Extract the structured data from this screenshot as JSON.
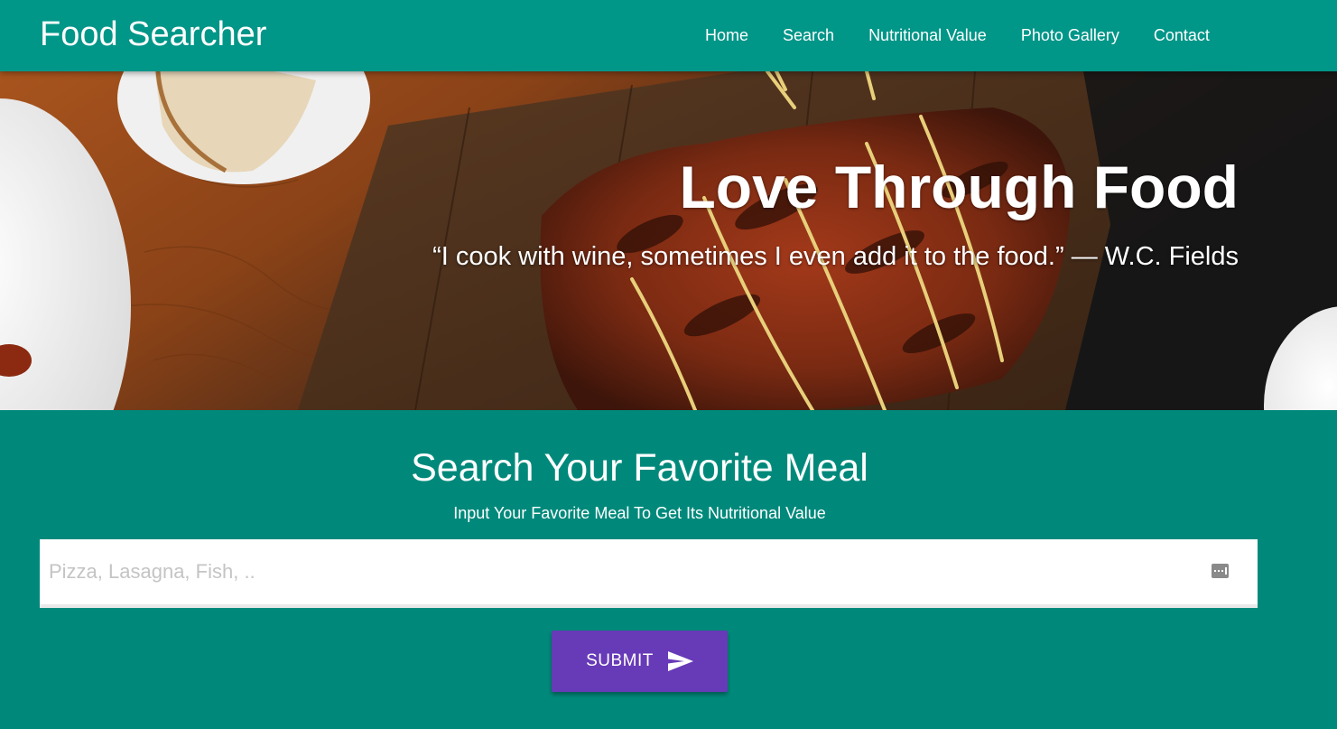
{
  "navbar": {
    "brand": "Food Searcher",
    "links": [
      "Home",
      "Search",
      "Nutritional Value",
      "Photo Gallery",
      "Contact"
    ]
  },
  "hero": {
    "title": "Love Through Food",
    "quote": "“I cook with wine, sometimes I even add it to the food.” — W.C. Fields"
  },
  "search": {
    "heading": "Search Your Favorite Meal",
    "subheading": "Input Your Favorite Meal To Get Its Nutritional Value",
    "placeholder": "Pizza, Lasagna, Fish, ..",
    "value": "",
    "submit_label": "SUBMIT"
  },
  "colors": {
    "navbar": "#009688",
    "section": "#00897b",
    "submit": "#673ab7"
  },
  "icons": {
    "input": "autofill-icon",
    "submit": "send-icon"
  }
}
